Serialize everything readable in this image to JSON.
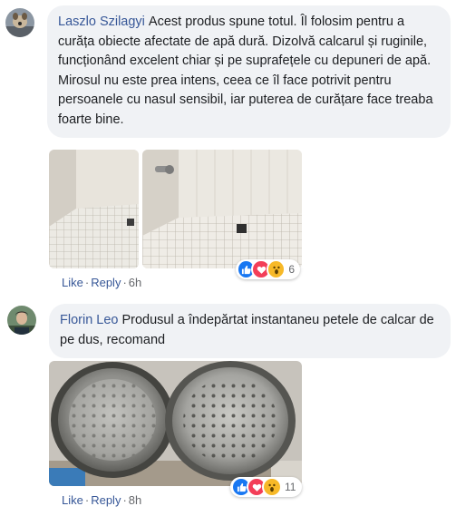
{
  "comments": [
    {
      "author": "Laszlo Szilagyi",
      "text": "Acest produs spune totul. Îl folosim pentru a curăța obiecte afectate de apă dură. Dizolvă calcarul și ruginile, funcționând excelent chiar și pe suprafețele cu depuneri de apă. Mirosul nu este prea intens, ceea ce îl face potrivit pentru persoanele cu nasul sensibil, iar puterea de curățare face treaba foarte bine.",
      "like_label": "Like",
      "reply_label": "Reply",
      "time": "6h",
      "reaction_count": "6"
    },
    {
      "author": "Florin Leo",
      "text": "Produsul a îndepărtat instantaneu petele de calcar de pe dus, recomand",
      "like_label": "Like",
      "reply_label": "Reply",
      "time": "8h",
      "reaction_count": "11"
    }
  ],
  "separator": "·",
  "reaction_icons": [
    "like-icon",
    "heart-icon",
    "wow-icon"
  ],
  "colors": {
    "link": "#385898",
    "bubble": "#f0f2f5",
    "like": "#1877f2",
    "love": "#f33e58",
    "wow": "#f7b928",
    "meta": "#65676b"
  }
}
